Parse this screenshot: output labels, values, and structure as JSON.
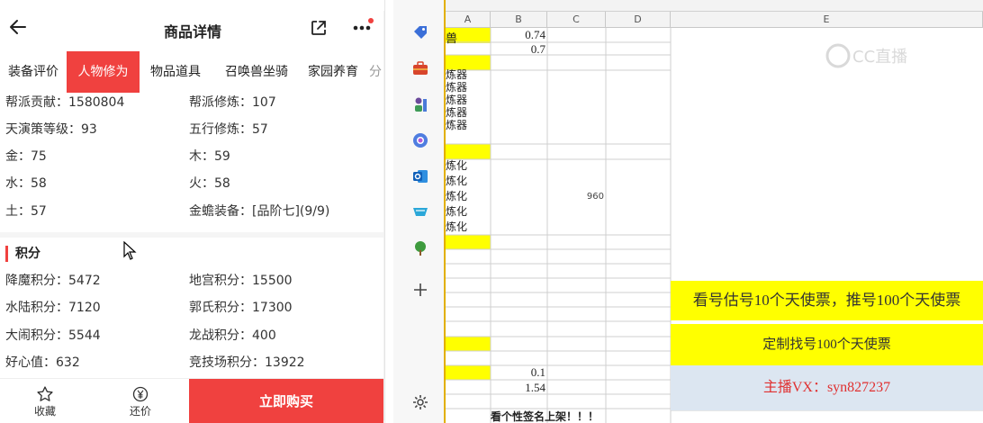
{
  "app": {
    "title": "商品详情"
  },
  "tabs": [
    {
      "label": "装备评价",
      "active": false
    },
    {
      "label": "人物修为",
      "active": true
    },
    {
      "label": "物品道具",
      "active": false
    },
    {
      "label": "召唤兽坐骑",
      "active": false
    },
    {
      "label": "家园养育",
      "active": false
    },
    {
      "label": "分",
      "active": false
    }
  ],
  "stats_rows": [
    {
      "left": "帮派贡献：1580804",
      "right": "帮派修炼：107"
    },
    {
      "left": "天演策等级：93",
      "right": "五行修炼：57"
    },
    {
      "left": "金：75",
      "right": "木：59"
    },
    {
      "left": "水：58",
      "right": "火：58"
    },
    {
      "left": "土：57",
      "right": "金蟾装备：[品阶七](9/9)"
    }
  ],
  "points_section": {
    "title": "积分",
    "rows": [
      {
        "left": "降魔积分：5472",
        "right": "地宫积分：15500"
      },
      {
        "left": "水陆积分：7120",
        "right": "郭氏积分：17300"
      },
      {
        "left": "大闹积分：5544",
        "right": "龙战积分：400"
      },
      {
        "left": "好心值：632",
        "right": "竞技场积分：13922"
      }
    ]
  },
  "bottom_bar": {
    "favorite_label": "收藏",
    "bargain_label": "还价",
    "buy_label": "立即购买"
  },
  "colors": {
    "accent": "#f0413f",
    "sheet_yellow": "#ffff00",
    "sheet_blue": "#dce6f1"
  },
  "sidebar_icons": [
    "tag-icon",
    "toolbox-icon",
    "chess-icon",
    "copilot-icon",
    "outlook-icon",
    "shopping-icon",
    "tree-icon",
    "plus-icon",
    "settings-icon"
  ],
  "sheet": {
    "columns": [
      "A",
      "B",
      "C",
      "D",
      "E"
    ],
    "a_fragments": [
      "兽",
      "炼器",
      "炼器",
      "炼器",
      "炼器",
      "炼器",
      "炼化",
      "炼化",
      "炼化",
      "炼化",
      "炼化"
    ],
    "b_values": [
      "0.74",
      "0.7",
      "0.1",
      "1.54"
    ],
    "c_values": [
      "960"
    ],
    "banner1": "看号估号10个天使票，推号100个天使票",
    "banner2": "定制找号100个天使票",
    "banner3": "主播VX：syn827237",
    "bottom_text": "看个性签名上架！！！",
    "watermark": "CC直播"
  }
}
